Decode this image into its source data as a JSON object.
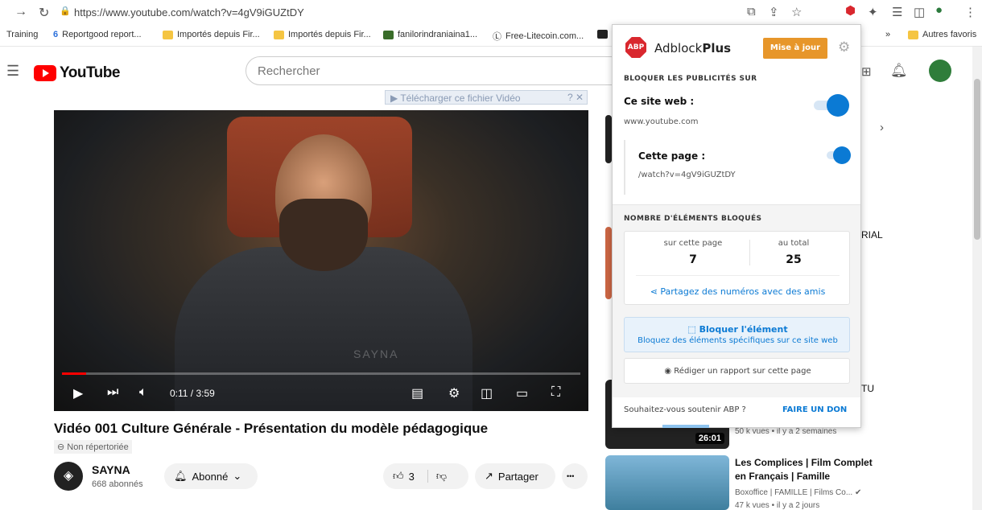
{
  "browser": {
    "url": "https://www.youtube.com/watch?v=4gV9iGUZtDY",
    "bookmarks": [
      {
        "label": "Training"
      },
      {
        "label": "Reportgood report..."
      },
      {
        "label": "Importés depuis Fir..."
      },
      {
        "label": "Importés depuis Fir..."
      },
      {
        "label": "fanilorindraniaina1..."
      },
      {
        "label": "Free-Litecoin.com..."
      }
    ],
    "more_bookmarks": "»",
    "other_bookmarks": "Autres favoris"
  },
  "youtube": {
    "logo_text": "YouTube",
    "search_placeholder": "Rechercher",
    "download_bar": "▶ Télécharger ce fichier Vidéo",
    "player": {
      "time": "0:11 / 3:59",
      "progress": 0.046,
      "watermark": "SAYNA"
    },
    "video_title": "Vidéo 001 Culture Générale - Présentation du modèle pédagogique",
    "unlisted": "⊖ Non répertoriée",
    "channel": {
      "name": "SAYNA",
      "subscribers": "668 abonnés",
      "avatar_glyph": "◈"
    },
    "subscribe_label": "Abonné",
    "like_count": "3",
    "share_label": "Partager",
    "more_label": "•••",
    "sidebar": {
      "partial_1": "RIAL",
      "partial_2": "TU",
      "views_1": "50 k vues • il y a 2 semaines",
      "duration_1": "26:01",
      "item_title": "Les Complices | Film Complet en Français | Famille",
      "item_channel": "Boxoffice | FAMILLE | Films Co...",
      "item_views": "47 k vues • il y a 2 jours"
    }
  },
  "abp": {
    "logo_text": "ABP",
    "brand_light": "Adblock",
    "brand_bold": "Plus",
    "update_button": "Mise à jour",
    "section_block": "BLOQUER LES PUBLICITÉS SUR",
    "site_label": "Ce site web :",
    "site_domain": "www.youtube.com",
    "page_label": "Cette page :",
    "page_path": "/watch?v=4gV9iGUZtDY",
    "section_count": "NOMBRE D'ÉLÉMENTS BLOQUÉS",
    "on_page_label": "sur cette page",
    "on_page_value": "7",
    "total_label": "au total",
    "total_value": "25",
    "share_numbers": "⋖ Partagez des numéros avec des amis",
    "block_element_title": "Bloquer l'élément",
    "block_element_desc": "Bloquez des éléments spécifiques sur ce site web",
    "report_label": "Rédiger un rapport sur cette page",
    "support_question": "Souhaitez-vous soutenir ABP ?",
    "donate_label": "FAIRE UN DON",
    "accent_color": "#0b7ad4",
    "update_color": "#e7962a"
  }
}
